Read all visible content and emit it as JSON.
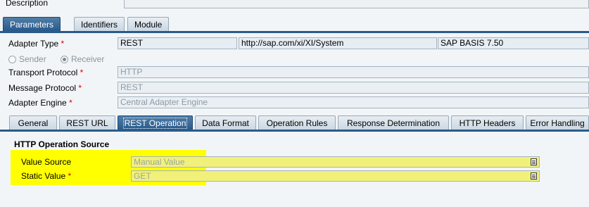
{
  "description": {
    "label": "Description",
    "value": ""
  },
  "top_tabs": [
    {
      "label": "Parameters",
      "active": true
    },
    {
      "label": "Identifiers",
      "active": false
    },
    {
      "label": "Module",
      "active": false
    }
  ],
  "adapter": {
    "type_label": "Adapter Type",
    "type_value": "REST",
    "namespace_value": "http://sap.com/xi/XI/System",
    "version_value": "SAP BASIS 7.50",
    "sender_label": "Sender",
    "receiver_label": "Receiver",
    "selected_role": "Receiver",
    "transport_label": "Transport Protocol",
    "transport_value": "HTTP",
    "message_label": "Message Protocol",
    "message_value": "REST",
    "engine_label": "Adapter Engine",
    "engine_value": "Central Adapter Engine",
    "required_mark": "*"
  },
  "sub_tabs": [
    {
      "label": "General",
      "active": false
    },
    {
      "label": "REST URL",
      "active": false
    },
    {
      "label": "REST Operation",
      "active": true
    },
    {
      "label": "Data Format",
      "active": false
    },
    {
      "label": "Operation Rules",
      "active": false
    },
    {
      "label": "Response Determination",
      "active": false
    },
    {
      "label": "HTTP Headers",
      "active": false
    },
    {
      "label": "Error Handling",
      "active": false
    }
  ],
  "operation": {
    "section_title": "HTTP Operation Source",
    "value_source_label": "Value Source",
    "value_source_value": "Manual Value",
    "static_value_label": "Static Value",
    "static_value_value": "GET",
    "highlight_color": "#ffff00"
  },
  "colors": {
    "active_tab": "#2a5b8c",
    "required": "#d40000"
  }
}
